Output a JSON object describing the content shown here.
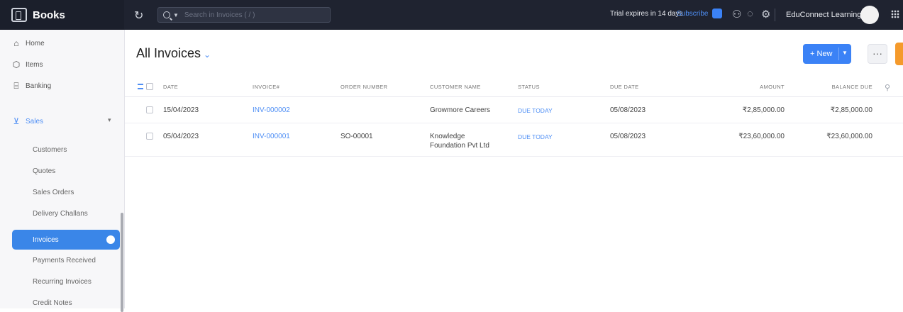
{
  "app": {
    "name": "Books",
    "brand_icon": "books-logo-icon"
  },
  "header": {
    "search_placeholder": "Search in Invoices ( / )",
    "trial_text": "Trial expires in 14 days",
    "subscribe_label": "Subscribe",
    "org_name": "EduConnect Learning...",
    "org_caret": "▾",
    "accent": "#3b82f6"
  },
  "sidebar": {
    "items": [
      {
        "label": "Home",
        "icon": "home-icon"
      },
      {
        "label": "Items",
        "icon": "items-icon"
      },
      {
        "label": "Banking",
        "icon": "bank-icon"
      }
    ],
    "sales": {
      "label": "Sales",
      "icon": "cart-icon",
      "expanded": true,
      "subitems": [
        "Customers",
        "Quotes",
        "Sales Orders",
        "Delivery Challans",
        "Invoices",
        "Payments Received",
        "Recurring Invoices",
        "Credit Notes"
      ],
      "active": "Invoices"
    }
  },
  "main": {
    "title": "All Invoices",
    "new_button": "+ New",
    "more_button": "···",
    "columns": [
      "DATE",
      "INVOICE#",
      "ORDER NUMBER",
      "CUSTOMER NAME",
      "STATUS",
      "DUE DATE",
      "AMOUNT",
      "BALANCE DUE"
    ],
    "rows": [
      {
        "date": "15/04/2023",
        "invoice": "INV-000002",
        "order_number": "",
        "customer": "Growmore Careers",
        "status": "DUE TODAY",
        "due_date": "05/08/2023",
        "amount": "₹2,85,000.00",
        "balance_due": "₹2,85,000.00"
      },
      {
        "date": "05/04/2023",
        "invoice": "INV-000001",
        "order_number": "SO-00001",
        "customer": "Knowledge Foundation Pvt Ltd",
        "status": "DUE TODAY",
        "due_date": "05/08/2023",
        "amount": "₹23,60,000.00",
        "balance_due": "₹23,60,000.00"
      }
    ]
  }
}
